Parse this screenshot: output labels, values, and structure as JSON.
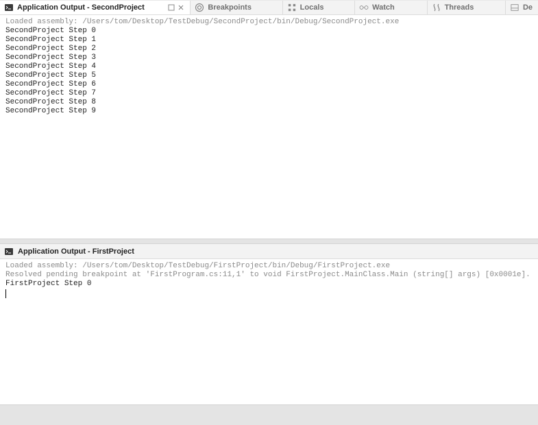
{
  "tabs": {
    "active": {
      "label": "Application Output - SecondProject"
    },
    "items": [
      {
        "label": "Breakpoints"
      },
      {
        "label": "Locals"
      },
      {
        "label": "Watch"
      },
      {
        "label": "Threads"
      },
      {
        "label": "De"
      }
    ]
  },
  "outputTop": {
    "loaded": "Loaded assembly: /Users/tom/Desktop/TestDebug/SecondProject/bin/Debug/SecondProject.exe",
    "lines": [
      "SecondProject Step 0",
      "SecondProject Step 1",
      "SecondProject Step 2",
      "SecondProject Step 3",
      "SecondProject Step 4",
      "SecondProject Step 5",
      "SecondProject Step 6",
      "SecondProject Step 7",
      "SecondProject Step 8",
      "SecondProject Step 9"
    ]
  },
  "bottom": {
    "title": "Application Output - FirstProject",
    "loaded": "Loaded assembly: /Users/tom/Desktop/TestDebug/FirstProject/bin/Debug/FirstProject.exe",
    "resolved": "Resolved pending breakpoint at 'FirstProgram.cs:11,1' to void FirstProject.MainClass.Main (string[] args) [0x0001e].",
    "line": "FirstProject Step 0"
  }
}
